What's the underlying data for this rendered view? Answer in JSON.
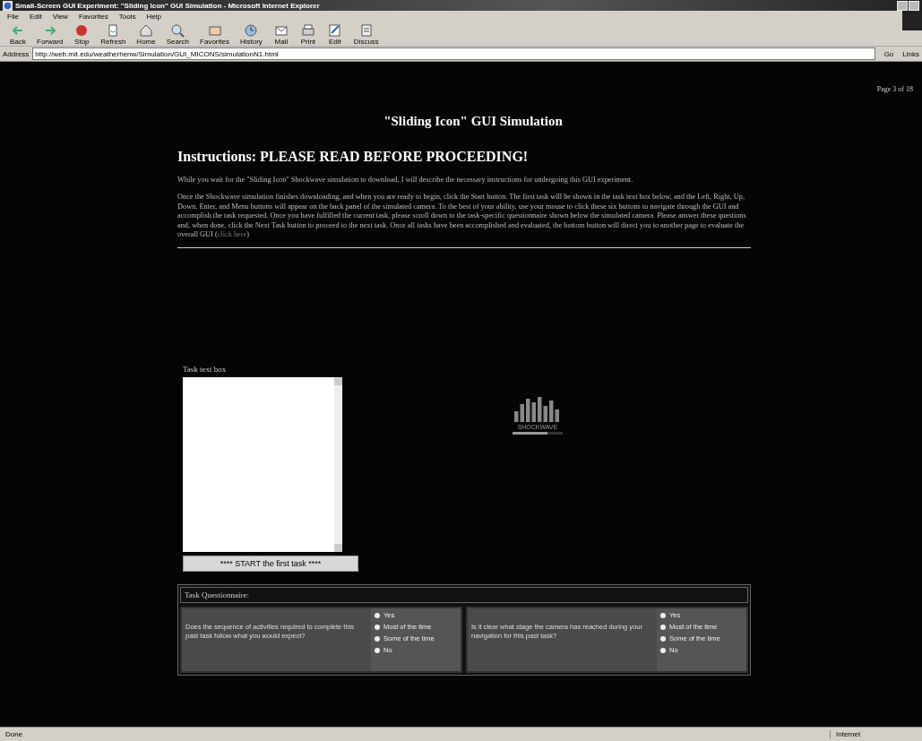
{
  "window": {
    "title": "Small-Screen GUI Experiment: \"Sliding Icon\" GUI Simulation - Microsoft Internet Explorer"
  },
  "menu": [
    "File",
    "Edit",
    "View",
    "Favorites",
    "Tools",
    "Help"
  ],
  "toolbar": [
    {
      "label": "Back",
      "kind": "back"
    },
    {
      "label": "Forward",
      "kind": "forward"
    },
    {
      "label": "Stop",
      "kind": "stop"
    },
    {
      "label": "Refresh",
      "kind": "refresh"
    },
    {
      "label": "Home",
      "kind": "home"
    },
    {
      "label": "Search",
      "kind": "search"
    },
    {
      "label": "Favorites",
      "kind": "favorites"
    },
    {
      "label": "History",
      "kind": "history"
    },
    {
      "label": "Mail",
      "kind": "mail"
    },
    {
      "label": "Print",
      "kind": "print"
    },
    {
      "label": "Edit",
      "kind": "edit"
    },
    {
      "label": "Discuss",
      "kind": "discuss"
    }
  ],
  "address": {
    "label": "Address",
    "value": "http://web.mit.edu/weatherhenw/Simulation/GUI_MICONS/simulationN1.html",
    "go": "Go",
    "links": "Links"
  },
  "page": {
    "counter": "Page 3 of 18",
    "title": "\"Sliding Icon\" GUI Simulation",
    "heading": "Instructions: PLEASE READ BEFORE PROCEEDING!",
    "paragraphs": [
      "While you wait for the \"Sliding Icon\" Shockwave simulation to download, I will describe the necessary instructions for undergoing this GUI experiment.",
      "Once the Shockwave simulation finishes downloading, and when you are ready to begin, click the Start button. The first task will be shown in the task text box below, and the Left, Right, Up, Down, Enter, and Menu buttons will appear on the back panel of the simulated camera. To the best of your ability, use your mouse to click these six buttons to navigate through the GUI and accomplish the task requested. Once you have fulfilled the current task, please scroll down to the task-specific questionnaire shown below the simulated camera. Please answer these questions and, when done, click the Next Task button to proceed to the next task. Once all tasks have been accomplished and evaluated, the bottom button will direct you to another page to evaluate the overall GUI ("
    ],
    "link": "click here",
    "paragraph_end": ")",
    "task_box": {
      "label": "Task text box"
    },
    "start_button": "**** START the first task ****",
    "loader": {
      "label": "SHOCKWAVE",
      "level": 0.7
    },
    "questionnaire": {
      "title": "Task Questionnaire:",
      "questions": [
        {
          "text": "Does the sequence of activities required to complete this past task follow what you would expect?",
          "options": [
            "Yes",
            "Most of the time",
            "Some of the time",
            "No"
          ]
        },
        {
          "text": "Is it clear what stage the camera has reached during your navigation for this past task?",
          "options": [
            "Yes",
            "Most of the time",
            "Some of the time",
            "No"
          ]
        }
      ]
    }
  },
  "status_bar": {
    "text": "Done",
    "zone": "Internet"
  }
}
